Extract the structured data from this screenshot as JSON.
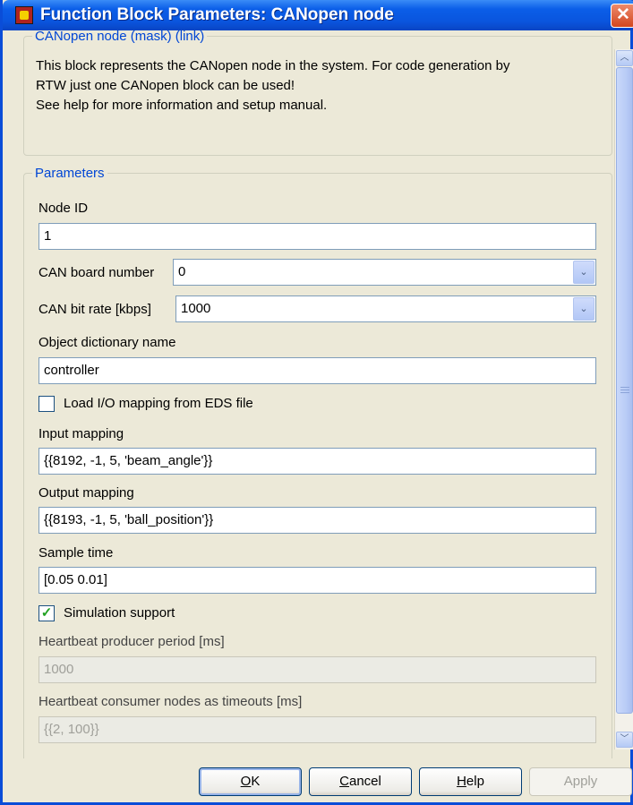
{
  "window": {
    "title": "Function Block Parameters: CANopen node",
    "close_glyph": "✕"
  },
  "description": {
    "legend": "CANopen node (mask) (link)",
    "lines": [
      "This block represents the CANopen node in the system. For code generation by",
      "RTW just one CANopen block can be used!",
      "See help for more information and setup manual."
    ]
  },
  "parameters": {
    "legend": "Parameters",
    "node_id": {
      "label": "Node ID",
      "value": "1"
    },
    "can_board": {
      "label": "CAN board number",
      "value": "0"
    },
    "can_bitrate": {
      "label": "CAN bit rate [kbps]",
      "value": "1000"
    },
    "object_dictionary": {
      "label": "Object dictionary name",
      "value": "controller"
    },
    "load_io": {
      "label": "Load I/O mapping from EDS file",
      "checked": false
    },
    "input_mapping": {
      "label": "Input mapping",
      "value": "{{8192, -1, 5, 'beam_angle'}}"
    },
    "output_mapping": {
      "label": "Output mapping",
      "value": "{{8193, -1, 5, 'ball_position'}}"
    },
    "sample_time": {
      "label": "Sample time",
      "value": "[0.05 0.01]"
    },
    "simulation_support": {
      "label": "Simulation support",
      "checked": true,
      "check_glyph": "✓"
    },
    "heartbeat_producer": {
      "label": "Heartbeat producer period [ms]",
      "value": "1000"
    },
    "heartbeat_consumer": {
      "label": "Heartbeat consumer nodes as timeouts [ms]",
      "value": "{{2, 100}}"
    }
  },
  "buttons": {
    "ok": {
      "mnemonic": "O",
      "rest": "K"
    },
    "cancel": {
      "mnemonic": "C",
      "rest": "ancel"
    },
    "help": {
      "mnemonic": "H",
      "rest": "elp"
    },
    "apply": {
      "label": "Apply"
    }
  },
  "icons": {
    "combo_arrow": "⌄",
    "scroll_up": "︿",
    "scroll_down": "﹀"
  },
  "colors": {
    "titlebar": "#0a55de",
    "legend_text": "#0046d5",
    "dialog_bg": "#ece9d8",
    "check_mark": "#21a121"
  }
}
